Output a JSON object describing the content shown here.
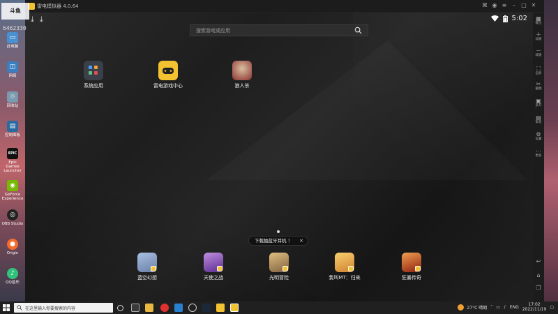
{
  "window": {
    "title": "雷电模拟器 4.0.64"
  },
  "overlay": {
    "logo_text": "斗鱼",
    "room_number": "6462330"
  },
  "status": {
    "time": "5:02"
  },
  "search": {
    "placeholder": "搜索游戏或应用"
  },
  "top_apps": [
    {
      "label": "系统应用",
      "color": "#3a3f4a"
    },
    {
      "label": "雷电游戏中心",
      "color": "#f2c230"
    },
    {
      "label": "狼人杀",
      "color": "#8b3030"
    }
  ],
  "dock_apps": [
    {
      "label": "蓝空幻想",
      "color": "#6a7fa8"
    },
    {
      "label": "天使之战",
      "color": "#7a4ab0"
    },
    {
      "label": "光明冒险",
      "color": "#b08850"
    },
    {
      "label": "我叫MT：归来",
      "color": "#e0a040"
    },
    {
      "label": "狂暴传奇",
      "color": "#c06020"
    }
  ],
  "tooltip": {
    "text": "下载抽蓝牙耳机 ！",
    "close": "×"
  },
  "sidebar": [
    {
      "glyph": "▦",
      "label": "键位"
    },
    {
      "glyph": "＋",
      "label": "加速"
    },
    {
      "glyph": "－",
      "label": "减速"
    },
    {
      "glyph": "⛶",
      "label": "全屏"
    },
    {
      "glyph": "✂",
      "label": "截图"
    },
    {
      "glyph": "▣",
      "label": "多开"
    },
    {
      "glyph": "▤",
      "label": "安装"
    },
    {
      "glyph": "⚙",
      "label": "设置"
    },
    {
      "glyph": "⋯",
      "label": "更多"
    }
  ],
  "desktop_icons": [
    {
      "label": "此电脑",
      "color": "#4a90d0"
    },
    {
      "label": "网络",
      "color": "#3a80c0"
    },
    {
      "label": "回收站",
      "color": "#7a9ab0"
    },
    {
      "label": "控制面板",
      "color": "#2a6aa0"
    },
    {
      "label": "Epic Games Launcher",
      "color": "#111111",
      "glyph": "EPIC"
    },
    {
      "label": "GeForce Experience",
      "color": "#76b900"
    },
    {
      "label": "OBS Studio",
      "color": "#222222"
    },
    {
      "label": "Origin",
      "color": "#f56c2d"
    },
    {
      "label": "QQ音乐",
      "color": "#31c27c"
    }
  ],
  "taskbar": {
    "search_placeholder": "在这里输入你要搜索的内容",
    "weather": "27°C 晴朗",
    "lang": "ENG",
    "time": "17:02",
    "date": "2022/11/19"
  }
}
